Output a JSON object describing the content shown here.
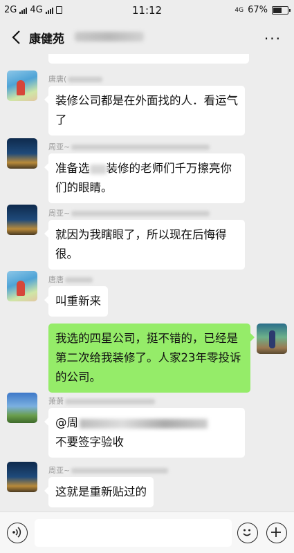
{
  "status": {
    "network_left": "2G",
    "network_mid": "4G",
    "time": "11:12",
    "network_right": "4G",
    "battery": "67%",
    "battery_level": 0.67
  },
  "nav": {
    "title": "康健苑"
  },
  "messages": [
    {
      "sender": "唐唐(",
      "text": "装修公司都是在外面找的人．看运气了",
      "side": "left"
    },
    {
      "sender": "周亚~",
      "text_a": "准备选",
      "text_b": "装修的老师们千万擦亮你们的眼睛。",
      "side": "left"
    },
    {
      "sender": "周亚~",
      "text": "就因为我瞎眼了，所以现在后悔得很。",
      "side": "left"
    },
    {
      "sender": "唐唐",
      "text": "叫重新来",
      "side": "left"
    },
    {
      "text": "我选的四星公司，挺不错的，已经是第二次给我装修了。人家23年零投诉的公司。",
      "side": "right"
    },
    {
      "sender": "萧萧",
      "mention": "@周",
      "text": "不要签字验收",
      "side": "left"
    },
    {
      "sender": "周亚~",
      "text": "这就是重新贴过的",
      "side": "left"
    }
  ],
  "colors": {
    "background": "#ededed",
    "bubble_left": "#ffffff",
    "bubble_right": "#95ec69"
  },
  "icons": {
    "back": "chevron-left-icon",
    "more": "more-icon",
    "voice": "voice-icon",
    "emoji": "emoji-icon",
    "add": "plus-icon"
  }
}
